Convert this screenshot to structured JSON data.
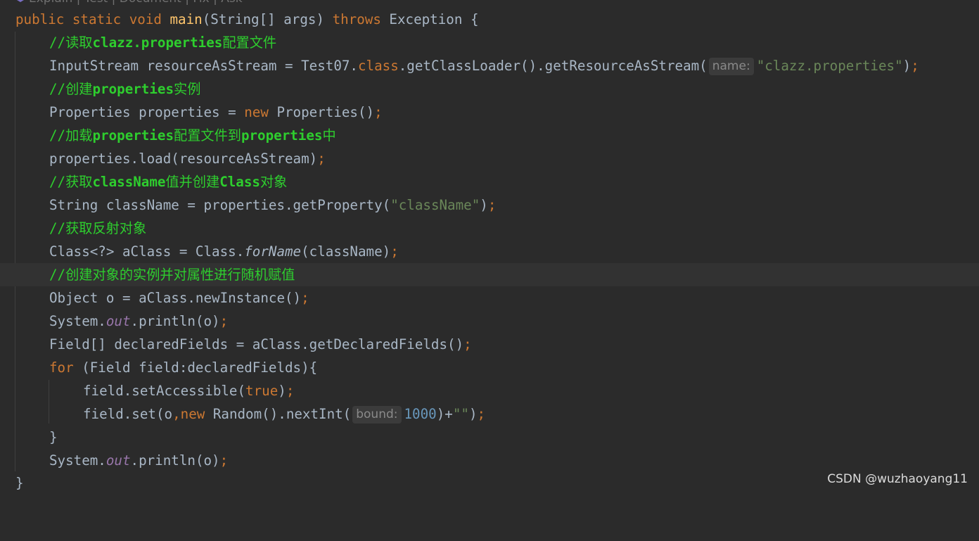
{
  "codelens": {
    "text": "Explain | Test | Document | Fix | Ask"
  },
  "code": {
    "l1": {
      "t1": "public static void ",
      "t2": "main",
      "t3": "(String[] args) ",
      "t4": "throws",
      "t5": " Exception {"
    },
    "l2": {
      "t1": "//读取",
      "t2": "clazz.properties",
      "t3": "配置文件"
    },
    "l3": {
      "t1": "InputStream resourceAsStream = Test07.",
      "t2": "class",
      "t3": ".getClassLoader().getResourceAsStream(",
      "hint": "name:",
      "t4": "\"clazz.properties\"",
      "t5": ")",
      "t6": ";"
    },
    "l4": {
      "t1": "//创建",
      "t2": "properties",
      "t3": "实例"
    },
    "l5": {
      "t1": "Properties properties = ",
      "t2": "new",
      "t3": " Properties()",
      "t4": ";"
    },
    "l6": {
      "t1": "//加载",
      "t2": "properties",
      "t3": "配置文件到",
      "t4": "properties",
      "t5": "中"
    },
    "l7": {
      "t1": "properties.load(resourceAsStream)",
      "t2": ";"
    },
    "l8": {
      "t1": "//获取",
      "t2": "className",
      "t3": "值并创建",
      "t4": "Class",
      "t5": "对象"
    },
    "l9": {
      "t1": "String className = properties.getProperty(",
      "t2": "\"className\"",
      "t3": ")",
      "t4": ";"
    },
    "l10": {
      "t1": "//获取反射对象"
    },
    "l11": {
      "t1": "Class<?> aClass = Class.",
      "t2": "forName",
      "t3": "(className)",
      "t4": ";"
    },
    "l12": {
      "t1": "//创建对象的实例并对属性进行随机赋值"
    },
    "l13": {
      "t1": "Object o = aClass.newInstance()",
      "t2": ";"
    },
    "l14": {
      "t1": "System.",
      "t2": "out",
      "t3": ".println(o)",
      "t4": ";"
    },
    "l15": {
      "t1": "Field[] declaredFields = aClass.getDeclaredFields()",
      "t2": ";"
    },
    "l16": {
      "t1": "for",
      "t2": " (Field field:declaredFields){"
    },
    "l17": {
      "t1": "field.setAccessible(",
      "t2": "true",
      "t3": ")",
      "t4": ";"
    },
    "l18": {
      "t1": "field.set(o",
      "t2": ",",
      "t3": "new",
      "t4": " Random().nextInt(",
      "hint": "bound:",
      "t5": "1000",
      "t6": ")+",
      "t7": "\"\"",
      "t8": ")",
      "t9": ";"
    },
    "l19": {
      "t1": "}"
    },
    "l20": {
      "t1": "System.",
      "t2": "out",
      "t3": ".println(o)",
      "t4": ";"
    },
    "l21": {
      "t1": "}"
    }
  },
  "watermark": {
    "text": "CSDN @wuzhaoyang11"
  },
  "colors": {
    "background": "#2b2b2b",
    "current_line": "#323232",
    "keyword": "#cc7832",
    "method_declaration": "#ffc66d",
    "string": "#6a8759",
    "number": "#6897bb",
    "comment": "#2ece2e",
    "static_field": "#9876aa",
    "default_text": "#a9b7c6"
  }
}
